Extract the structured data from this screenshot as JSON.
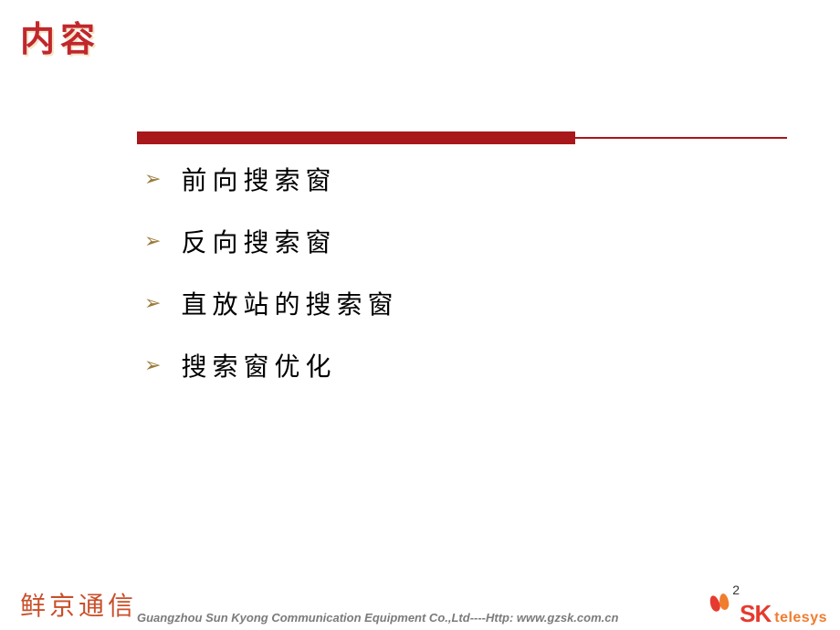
{
  "title": "内容",
  "bullets": [
    "前向搜索窗",
    "反向搜索窗",
    "直放站的搜索窗",
    "搜索窗优化"
  ],
  "footer": {
    "brand_cn": "鲜京通信",
    "company": "Guangzhou Sun Kyong Communication Equipment Co.,Ltd----Http: www.gzsk.com.cn",
    "logo_sk": "SK",
    "logo_telesys": "telesys"
  },
  "page_number": "2",
  "arrow_glyph": "➢"
}
